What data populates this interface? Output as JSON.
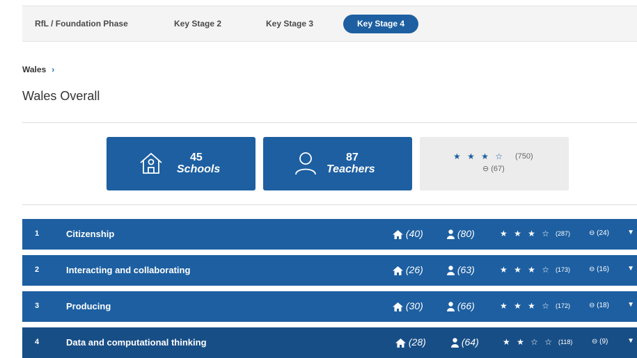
{
  "tabs": [
    {
      "label": "RfL / Foundation Phase",
      "active": false
    },
    {
      "label": "Key Stage 2",
      "active": false
    },
    {
      "label": "Key Stage 3",
      "active": false
    },
    {
      "label": "Key Stage 4",
      "active": true
    }
  ],
  "breadcrumb": {
    "label": "Wales",
    "chevron": "›"
  },
  "page_title": "Wales Overall",
  "summary": {
    "schools": {
      "count": "45",
      "label": "Schools",
      "icon": "school-icon"
    },
    "teachers": {
      "count": "87",
      "label": "Teachers",
      "icon": "teacher-icon"
    },
    "rating": {
      "stars": "★ ★ ★ ☆",
      "count": "(750)",
      "not_rated": "⊖ (67)"
    }
  },
  "rows": [
    {
      "index": "1",
      "title": "Citizenship",
      "schools": "(40)",
      "teachers": "(80)",
      "stars": "★ ★ ★ ☆",
      "rating_count": "(287)",
      "not_rated": "⊖ (24)",
      "caret": "▼"
    },
    {
      "index": "2",
      "title": "Interacting and collaborating",
      "schools": "(26)",
      "teachers": "(63)",
      "stars": "★ ★ ★ ☆",
      "rating_count": "(173)",
      "not_rated": "⊖ (16)",
      "caret": "▼"
    },
    {
      "index": "3",
      "title": "Producing",
      "schools": "(30)",
      "teachers": "(66)",
      "stars": "★ ★ ★ ☆",
      "rating_count": "(172)",
      "not_rated": "⊖ (18)",
      "caret": "▼"
    },
    {
      "index": "4",
      "title": "Data and computational thinking",
      "schools": "(28)",
      "teachers": "(64)",
      "stars": "★ ★ ☆ ☆",
      "rating_count": "(118)",
      "not_rated": "⊖ (9)",
      "caret": "▼"
    }
  ],
  "colors": {
    "primary": "#1d5fa1",
    "primary_dark": "#184e86",
    "panel": "#ececec"
  }
}
